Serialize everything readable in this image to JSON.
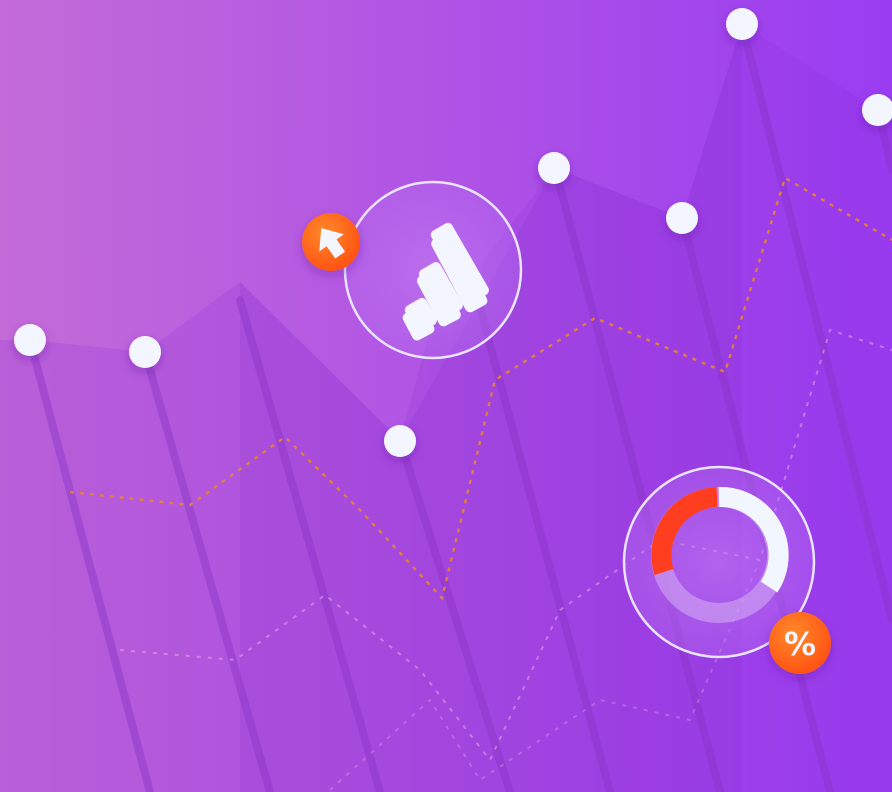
{
  "colors": {
    "bg_left": "#c46bd8",
    "bg_right": "#9a3cf2",
    "point": "#f4f6ff",
    "orange": "#ff6a1a",
    "red": "#ff3d1f",
    "white_arc": "#f2f6ff",
    "glass_ring": "#e9e4ff",
    "dotted_orange": "#e7852f"
  },
  "icons": {
    "bar_chart_badge": "bar-chart-icon",
    "arrow_badge": "arrow-up-icon",
    "donut_badge": "donut-chart-icon",
    "percent_badge": "percent-icon"
  },
  "labels": {
    "percent": "%"
  },
  "donut": {
    "red_fraction": 0.37,
    "white_fraction": 0.35,
    "faded_fraction": 0.28
  }
}
